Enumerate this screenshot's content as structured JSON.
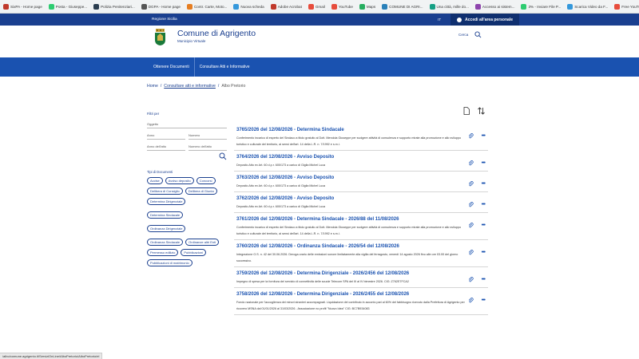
{
  "bookmarks": [
    {
      "label": "SixPA - Home page",
      "color": "#c0392b"
    },
    {
      "label": "Posta - Giuseppe...",
      "color": "#2ecc71"
    },
    {
      "label": "Polizia Penitenziari...",
      "color": "#2c3e50"
    },
    {
      "label": "DGPA - Home page",
      "color": "#555555"
    },
    {
      "label": "Contr. Carte, Moto...",
      "color": "#e67e22"
    },
    {
      "label": "Nuova scheda",
      "color": "#3498db"
    },
    {
      "label": "Adobe Acrobat",
      "color": "#c0392b"
    },
    {
      "label": "Gmail",
      "color": "#e74c3c"
    },
    {
      "label": "YouTube",
      "color": "#e74c3c"
    },
    {
      "label": "Maps",
      "color": "#27ae60"
    },
    {
      "label": "COMUNE DI AGRI...",
      "color": "#2980b9"
    },
    {
      "label": "Una città, mille do...",
      "color": "#16a085"
    },
    {
      "label": "Accesso ai sistem...",
      "color": "#8e44ad"
    },
    {
      "label": "3% - Inviare File P...",
      "color": "#2ecc71"
    },
    {
      "label": "Scarica Video da F...",
      "color": "#3498db"
    },
    {
      "label": "Free YouTube Dow...",
      "color": "#e74c3c"
    },
    {
      "label": "Scarica video di Y...",
      "color": "#e74c3c"
    }
  ],
  "bookmarks_more": "»",
  "topbar": {
    "region": "Regione Sicilia",
    "lang": "IT",
    "login": "Accedi all'area personale"
  },
  "header": {
    "title": "Comune di Agrigento",
    "subtitle": "Municipio Virtuale",
    "search_label": "Cerca"
  },
  "nav": {
    "items": [
      "Ottenere Documenti",
      "Consultare Atti e Informative"
    ]
  },
  "breadcrumb": {
    "home": "Home",
    "sep": "/",
    "level1": "Consultare atti e informative",
    "current": "Albo Pretorio"
  },
  "filters": {
    "label": "Filtri per",
    "oggetto": "Oggetto",
    "anno": "Anno",
    "numero": "Numero",
    "anno_atto": "Anno dell'atto",
    "numero_atto": "Numero dell'atto",
    "types_label": "Tipi di Documenti",
    "chips": [
      "Accise",
      "Avviso deposito",
      "Concorsi",
      "Delibera di Consiglio",
      "Delibera di Giunta",
      "Determina Dirigenziale",
      "Determina Sindacale",
      "Ordinanza Dirigenziale",
      "Ordinanza Sindacale",
      "Ordinanze altri Enti",
      "Permesso edilizio",
      "Pubblicazioni",
      "Pubblicazioni di matrimonio"
    ]
  },
  "entries": [
    {
      "title": "3765/2026 del 12/08/2026 - Determina Sindacale",
      "desc": "Conferimento incarico di esperto del Sindaco a titolo gratuito al Dott. Mendola Giuseppe per svolgere attività di consulenza e supporto mirate alla promozione e allo sviluppo turistico e culturale del territorio, ai sensi dell'art. 14 della L.R. n. 7/1992 e s.m.i."
    },
    {
      "title": "3764/2026 del 12/08/2026 - Avviso Deposito",
      "desc": "Deposito Atto ex Art. 60 d.p.r. 600/173 a carico di Giglia Michel Luca"
    },
    {
      "title": "3763/2026 del 12/08/2026 - Avviso Deposito",
      "desc": "Deposito Atto ex Art. 60 d.p.r. 600/173 a carico di Giglia Michel Luca"
    },
    {
      "title": "3762/2026 del 12/08/2026 - Avviso Deposito",
      "desc": "Deposito Atto ex Art. 60 d.p.r. 600/173 a carico di Giglia Michel Luca"
    },
    {
      "title": "3761/2026 del 12/08/2026 - Determina Sindacale - 2026/88 del 11/08/2026",
      "desc": "Conferimento incarico di esperto del Sindaco a titolo gratuito al Dott. Mendola Giuseppe per svolgere attività di consulenza e supporto mirate alla promozione e allo sviluppo turistico e culturale del territorio, ai sensi dell'art. 14 della L.R. n. 7/1992 e s.m.i."
    },
    {
      "title": "3760/2026 del 12/08/2026 - Ordinanza Sindacale - 2026/54 del 12/08/2026",
      "desc": "Integrazione O.S. n. 42 del 30.06.2026. Deroga orario delle emissioni sonore limitatamente alla vigilia del ferragosto, venerdì 14 agosto 2026 fino alle ore 03.00 del giorno successivo."
    },
    {
      "title": "3759/2026 del 12/08/2026 - Determina Dirigenziale - 2026/2456 del 12/08/2026",
      "desc": "Impegno di spesa per la fornitura del servizio di connettività delle scuole Telecom SPA del III al IV bimestre 2026. CIG: Z762E7FCA2"
    },
    {
      "title": "3758/2026 del 12/08/2026 - Determina Dirigenziale - 2026/2455 del 12/08/2026",
      "desc": "Fondo nazionale per l'accoglienza dei minori stranieri accompagnati. Liquidazione del contributo in acconto pari al 60% del fabbisogno ricevuto dalla Prefettura di Agrigento per ricovero MSNA dal 01/01/2026 al 31/03/2026 - Associazione no profit \"Nuovo Idea\" CIG: BC7B934083"
    }
  ],
  "status_url": "/albo/comune.agrigento.it/ServiziOnLine/AlboPretorio/AlboPretorio/el",
  "colors": {
    "primary": "#1a52b0",
    "dark": "#1a3f8f"
  }
}
